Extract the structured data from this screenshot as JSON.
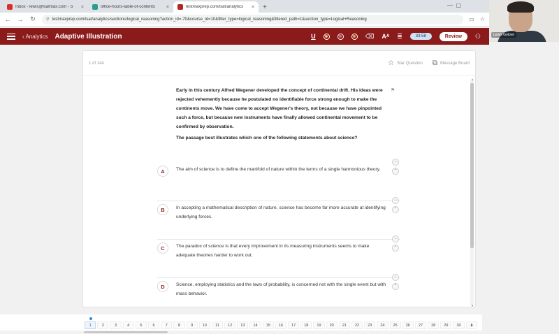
{
  "browser": {
    "tabs": [
      {
        "title": "Inbox - lewis@lsatmax.com - S",
        "favicon_color": "#d93025",
        "active": false
      },
      {
        "title": "office-hours-table-of-contents",
        "favicon_color": "#2a9d8f",
        "active": false
      },
      {
        "title": "testmaxprep.com/lsat/analytics",
        "favicon_color": "#b3261e",
        "active": true
      }
    ],
    "new_tab": "+",
    "url": "testmaxprep.com/lsat/analytics/sections/logical_reasoning?action_id=-70&course_id=10&filter_type=logical_reasoning&filtered_path=1&section_type=Logical+Reasoning"
  },
  "webcam": {
    "name": "Lewis Golove"
  },
  "app": {
    "back_label": "‹ Analytics",
    "title": "Adaptive Illustration",
    "timer": "33:58",
    "review_label": "Review",
    "accent_color": "#8b1a1a"
  },
  "card": {
    "counter": "1 of 144",
    "star_label": "Star Question",
    "board_label": "Message Board",
    "stimulus": "Early in this century Alfred Wegener developed the concept of continental drift. His ideas were rejected vehemently because he postulated no identifiable force strong enough to make the continents move. We have come to accept Wegener's theory, not because we have pinpointed such a force, but because new instruments have finally allowed continental movement to be confirmed by observation.",
    "stem": "The passage best illustrates which one of the following statements about science?",
    "choices": [
      {
        "letter": "A",
        "text": "The aim of science is to define the manifold of nature within the terms of a single harmonious theory."
      },
      {
        "letter": "B",
        "text": "In accepting a mathematical description of nature, science has become far more accurate at identifying underlying forces."
      },
      {
        "letter": "C",
        "text": "The paradox of science is that every improvement in its measuring instruments seems to make adequate theories harder to work out."
      },
      {
        "letter": "D",
        "text": "Science, employing statistics and the laws of probability, is concerned not with the single event but with mass behavior."
      }
    ]
  },
  "qnav": {
    "numbers": [
      "1",
      "2",
      "3",
      "4",
      "5",
      "6",
      "7",
      "8",
      "9",
      "10",
      "11",
      "12",
      "13",
      "14",
      "15",
      "16",
      "17",
      "18",
      "19",
      "20",
      "21",
      "22",
      "23",
      "24",
      "25",
      "26",
      "27",
      "28",
      "29",
      "30",
      "3"
    ],
    "current": "1"
  }
}
